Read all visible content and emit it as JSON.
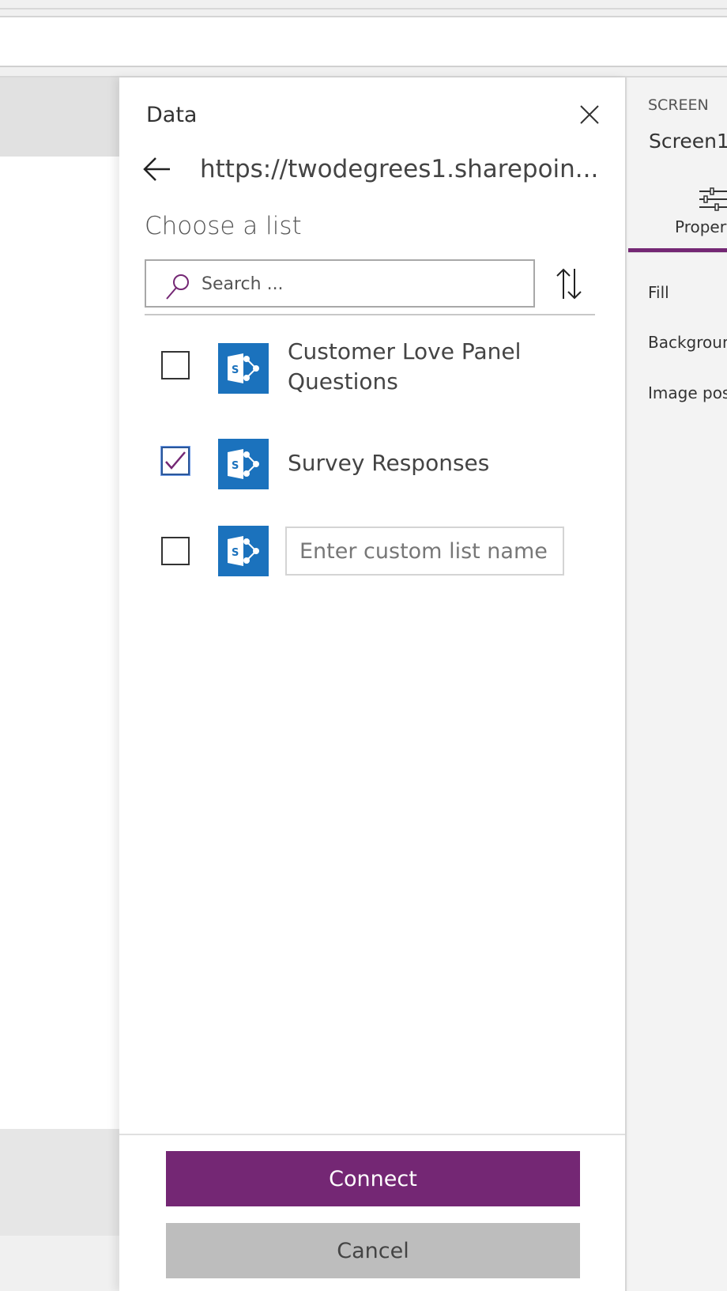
{
  "colors": {
    "accent": "#742774",
    "sharepoint_blue": "#1b72bd",
    "cancel_bg": "#bdbdbd"
  },
  "panel": {
    "title": "Data",
    "close_icon": "close-icon",
    "back_icon": "back-arrow-icon",
    "site_url": "https://twodegrees1.sharepoin...",
    "heading": "Choose a list",
    "search_placeholder": "Search ...",
    "sort_icon": "sort-icon",
    "lists": [
      {
        "name": "Customer Love Panel Questions",
        "line1": "Customer Love Panel",
        "line2": "Questions",
        "checked": false,
        "icon": "sharepoint-icon"
      },
      {
        "name": "Survey Responses",
        "checked": true,
        "icon": "sharepoint-icon"
      }
    ],
    "custom_list": {
      "checked": false,
      "placeholder": "Enter custom list name",
      "value": ""
    },
    "connect_label": "Connect",
    "cancel_label": "Cancel"
  },
  "right_panel": {
    "section": "SCREEN",
    "screen_name": "Screen1",
    "tab_label": "Properties",
    "properties": [
      "Fill",
      "Background image",
      "Image position"
    ]
  }
}
